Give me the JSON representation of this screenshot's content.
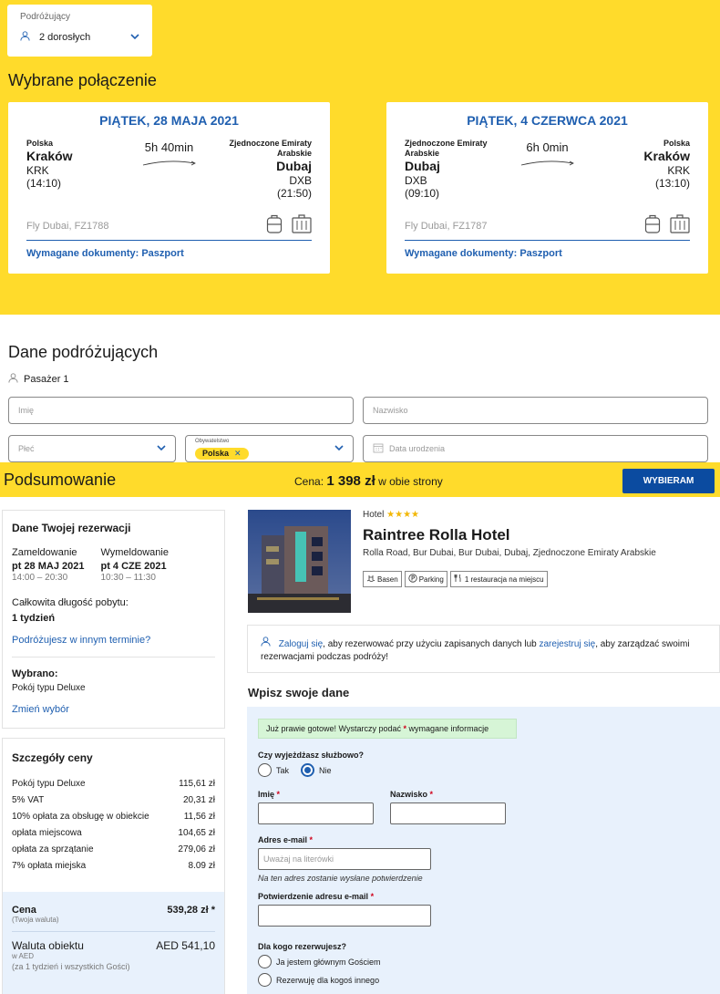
{
  "travelers": {
    "label": "Podróżujący",
    "value": "2 dorosłych"
  },
  "selected_heading": "Wybrane połączenie",
  "flights": [
    {
      "date": "PIĄTEK, 28 MAJA 2021",
      "duration": "5h 40min",
      "from": {
        "country": "Polska",
        "city": "Kraków",
        "code": "KRK",
        "time": "(14:10)"
      },
      "to": {
        "country": "Zjednoczone Emiraty Arabskie",
        "city": "Dubaj",
        "code": "DXB",
        "time": "(21:50)"
      },
      "airline": "Fly Dubai, FZ1788",
      "docs": "Wymagane dokumenty: Paszport"
    },
    {
      "date": "PIĄTEK, 4 CZERWCA 2021",
      "duration": "6h 0min",
      "from": {
        "country": "Zjednoczone Emiraty Arabskie",
        "city": "Dubaj",
        "code": "DXB",
        "time": "(09:10)"
      },
      "to": {
        "country": "Polska",
        "city": "Kraków",
        "code": "KRK",
        "time": "(13:10)"
      },
      "airline": "Fly Dubai, FZ1787",
      "docs": "Wymagane dokumenty: Paszport"
    }
  ],
  "passengers": {
    "heading": "Dane podróżujących",
    "passenger_label": "Pasażer 1",
    "first_name_placeholder": "Imię",
    "last_name_placeholder": "Nazwisko",
    "gender_placeholder": "Płeć",
    "citizenship_label": "Obywatelstwo",
    "citizenship_value": "Polska",
    "birthdate_placeholder": "Data urodzenia"
  },
  "summary": {
    "title": "Podsumowanie",
    "price_prefix": "Cena: ",
    "price_value": "1 398 zł",
    "price_suffix": " w obie strony",
    "select_button": "WYBIERAM"
  },
  "reservation": {
    "heading": "Dane Twojej rezerwacji",
    "checkin_label": "Zameldowanie",
    "checkin_date": "pt 28 MAJ 2021",
    "checkin_time": "14:00 – 20:30",
    "checkout_label": "Wymeldowanie",
    "checkout_date": "pt 4 CZE 2021",
    "checkout_time": "10:30 – 11:30",
    "stay_label": "Całkowita długość pobytu:",
    "stay_value": "1 tydzień",
    "other_dates_link": "Podróżujesz w innym terminie?",
    "selected_label": "Wybrano:",
    "selected_value": "Pokój typu Deluxe",
    "change_link": "Zmień wybór"
  },
  "price_details": {
    "heading": "Szczegóły ceny",
    "rows": [
      {
        "label": "Pokój typu Deluxe",
        "value": "115,61 zł"
      },
      {
        "label": "5% VAT",
        "value": "20,31 zł"
      },
      {
        "label": "10% opłata za obsługę w obiekcie",
        "value": "11,56 zł"
      },
      {
        "label": "opłata miejscowa",
        "value": "104,65 zł"
      },
      {
        "label": "opłata za sprzątanie",
        "value": "279,06 zł"
      },
      {
        "label": "7% opłata miejska",
        "value": "8.09 zł"
      }
    ],
    "total_label": "Cena",
    "total_value": "539,28 zł *",
    "total_sub": "(Twoja waluta)",
    "currency_label": "Waluta obiektu",
    "currency_value": "AED 541,10",
    "currency_sub1": "w AED",
    "currency_sub2": "(za 1 tydzień i wszystkich Gości)"
  },
  "hotel": {
    "type_label": "Hotel",
    "stars": "★★★★",
    "name": "Raintree Rolla Hotel",
    "address": "Rolla Road, Bur Dubai, Bur Dubai, Dubaj, Zjednoczone Emiraty Arabskie",
    "amenities": [
      "Basen",
      "Parking",
      "1 restauracja na miejscu"
    ]
  },
  "login": {
    "link1": "Zaloguj się",
    "text1": ", aby rezerwować przy użyciu zapisanych danych lub ",
    "link2": "zarejestruj się",
    "text2": ", aby zarządzać swoimi rezerwacjami podczas podróży!"
  },
  "form": {
    "heading": "Wpisz swoje dane",
    "notice_pre": "Już prawie gotowe! Wystarczy podać ",
    "notice_star": "*",
    "notice_post": " wymagane informacje",
    "business_q": "Czy wyjeżdżasz służbowo?",
    "yes": "Tak",
    "no": "Nie",
    "first_name": "Imię",
    "last_name": "Nazwisko",
    "email": "Adres e-mail",
    "email_placeholder": "Uważaj na literówki",
    "email_hint": "Na ten adres zostanie wysłane potwierdzenie",
    "email_confirm": "Potwierdzenie adresu e-mail",
    "req_star": "*",
    "for_whom_q": "Dla kogo rezerwujesz?",
    "opt_main": "Ja jestem głównym Gościem",
    "opt_other": "Rezerwuję dla kogoś innego"
  },
  "colors": {
    "brand_yellow": "#ffdb2b",
    "brand_blue": "#1f5fb0",
    "button_blue": "#0b4ba0"
  }
}
